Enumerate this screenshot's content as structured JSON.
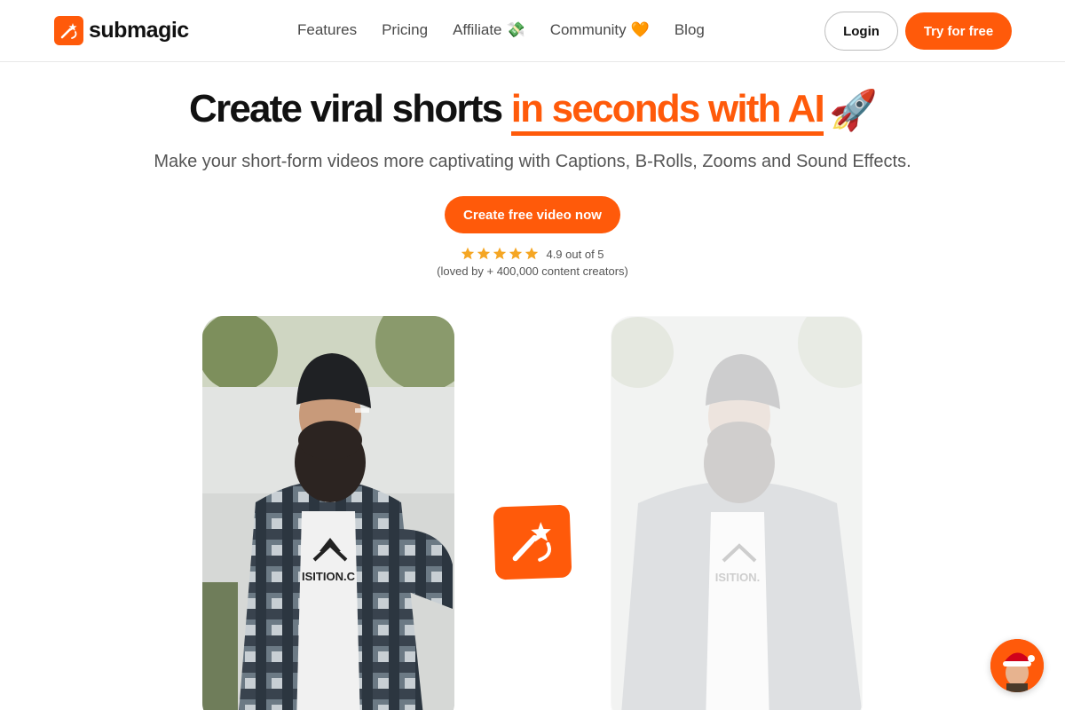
{
  "brand": {
    "name": "submagic",
    "accent_color": "#ff5a0a",
    "logo_icon": "magic-wand-icon"
  },
  "nav": {
    "items": [
      {
        "label": "Features"
      },
      {
        "label": "Pricing"
      },
      {
        "label": "Affiliate",
        "emoji": "💸"
      },
      {
        "label": "Community",
        "emoji": "🧡"
      },
      {
        "label": "Blog"
      }
    ]
  },
  "header": {
    "login_label": "Login",
    "try_label": "Try for free"
  },
  "hero": {
    "headline_plain": "Create viral shorts",
    "headline_accent": "in seconds with AI",
    "headline_emoji": "🚀",
    "subline": "Make your short-form videos more captivating with Captions, B-Rolls, Zooms and Sound Effects.",
    "cta_label": "Create free video now",
    "rating_stars": 5,
    "rating_text": "4.9 out of 5",
    "loved_text": "(loved by + 400,000 content creators)"
  },
  "videos": {
    "left_shirt_text": "ISITION.C",
    "right_shirt_text": "ISITION."
  }
}
